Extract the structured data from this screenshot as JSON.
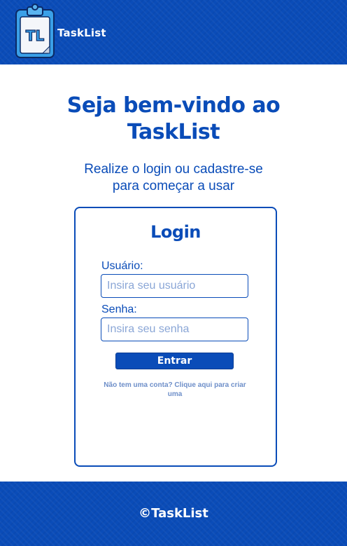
{
  "colors": {
    "primary": "#0a4cb8",
    "link": "#6e8fc9",
    "background": "#ffffff"
  },
  "header": {
    "logo_icon": "clipboard-tl-logo",
    "logo_text": "TL",
    "brand": "TaskList"
  },
  "hero": {
    "title_line1": "Seja bem-vindo ao",
    "title_line2": "TaskList",
    "subtitle_line1": "Realize o login ou cadastre-se",
    "subtitle_line2": "para começar a usar"
  },
  "login": {
    "title": "Login",
    "username_label": "Usuário:",
    "username_value": "",
    "username_placeholder": "Insira seu usuário",
    "password_label": "Senha:",
    "password_value": "",
    "password_placeholder": "Insira seu senha",
    "submit_label": "Entrar",
    "signup_link": "Não tem uma conta? Clique aqui para criar uma"
  },
  "footer": {
    "copyright": "©TaskList"
  }
}
